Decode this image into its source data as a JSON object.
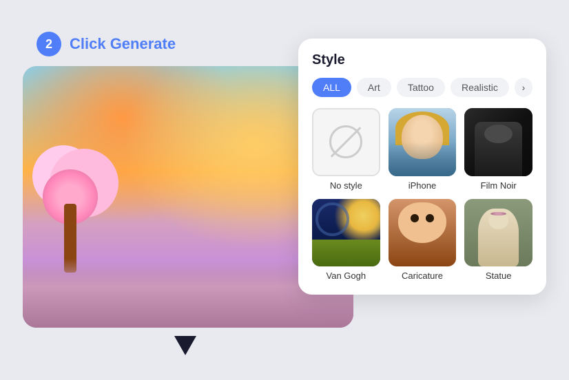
{
  "step": {
    "number": "2",
    "label": "Click Generate"
  },
  "style_panel": {
    "title": "Style",
    "filters": [
      {
        "id": "all",
        "label": "ALL",
        "active": true
      },
      {
        "id": "art",
        "label": "Art",
        "active": false
      },
      {
        "id": "tattoo",
        "label": "Tattoo",
        "active": false
      },
      {
        "id": "realistic",
        "label": "Realistic",
        "active": false
      }
    ],
    "more_icon": "›",
    "styles": [
      {
        "id": "no-style",
        "label": "No style",
        "type": "no-style"
      },
      {
        "id": "iphone",
        "label": "iPhone",
        "type": "iphone"
      },
      {
        "id": "film-noir",
        "label": "Film Noir",
        "type": "film-noir"
      },
      {
        "id": "van-gogh",
        "label": "Van Gogh",
        "type": "van-gogh"
      },
      {
        "id": "caricature",
        "label": "Caricature",
        "type": "caricature"
      },
      {
        "id": "statue",
        "label": "Statue",
        "type": "statue"
      }
    ]
  }
}
